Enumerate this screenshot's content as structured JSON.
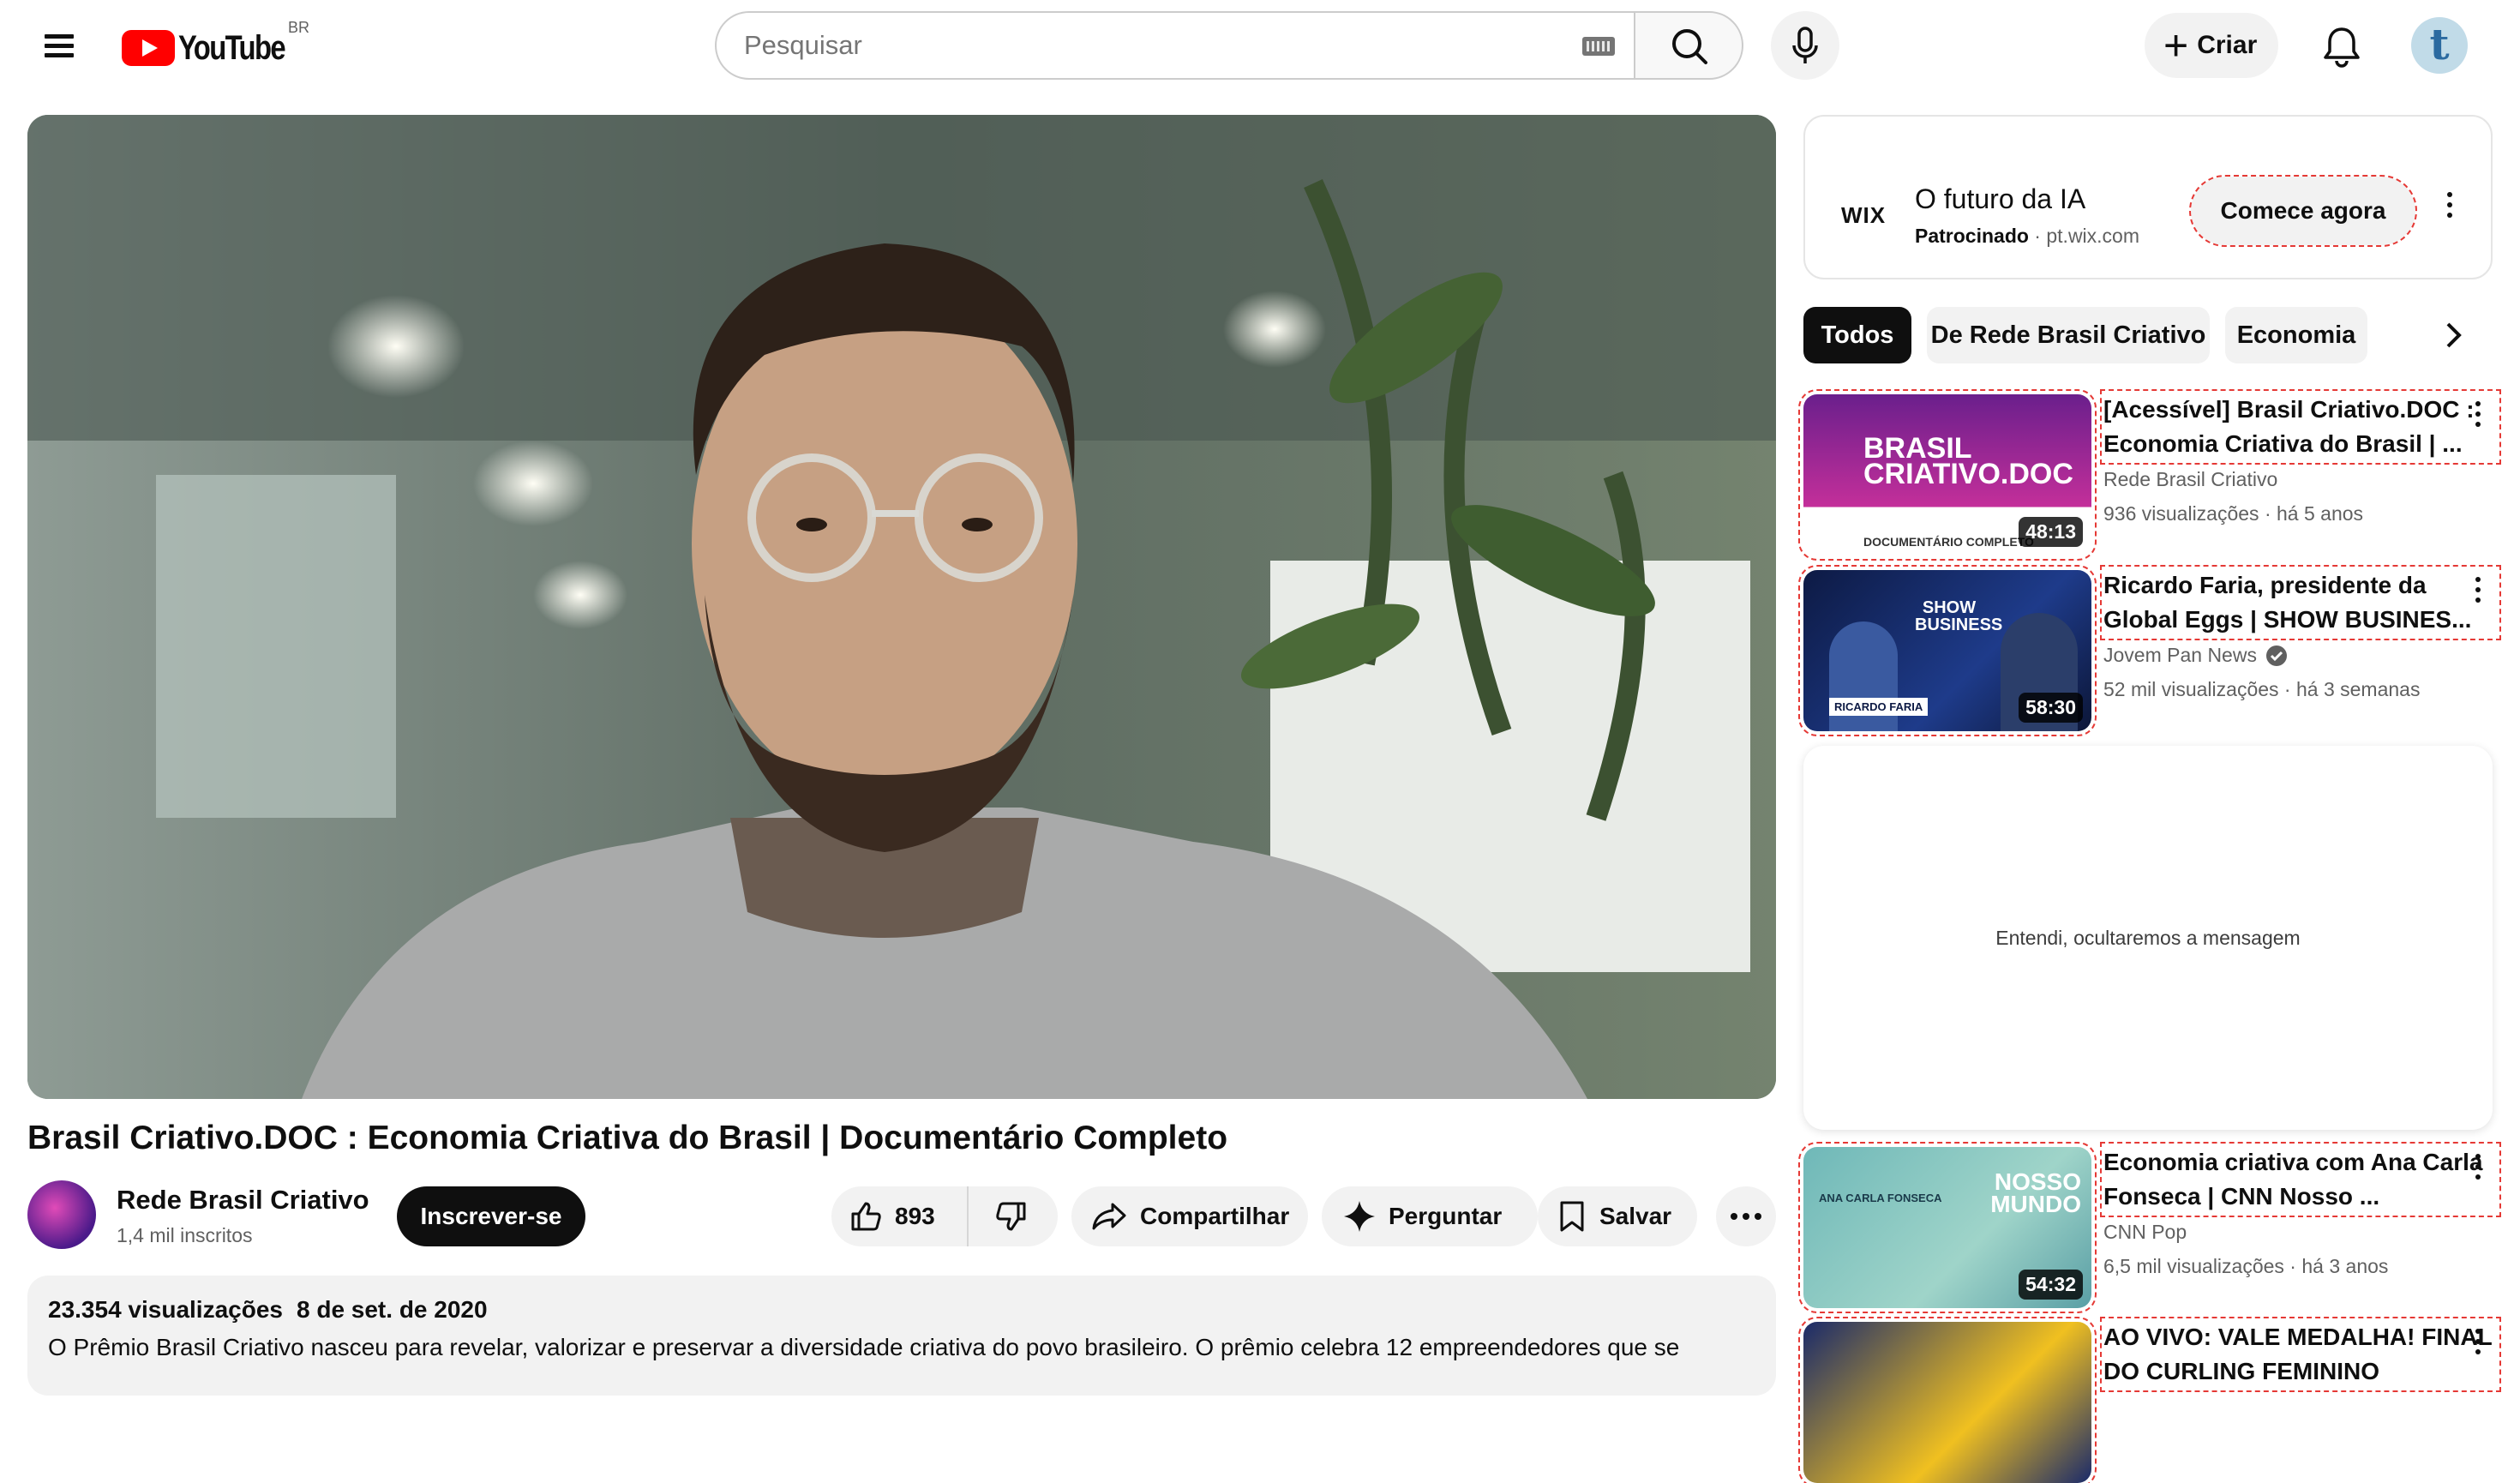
{
  "header": {
    "logo_text": "YouTube",
    "region": "BR",
    "search_placeholder": "Pesquisar",
    "create_label": "Criar",
    "avatar_letter": "t",
    "icons": [
      "menu-icon",
      "keyboard-icon",
      "search-icon",
      "mic-icon",
      "plus-icon",
      "bell-icon"
    ]
  },
  "video": {
    "title": "Brasil Criativo.DOC : Economia Criativa do Brasil | Documentário Completo",
    "channel": "Rede Brasil Criativo",
    "subscribers": "1,4 mil inscritos",
    "subscribe_label": "Inscrever-se",
    "likes": "893",
    "share_label": "Compartilhar",
    "ask_label": "Perguntar",
    "save_label": "Salvar",
    "views": "23.354 visualizações",
    "date": "8 de set. de 2020",
    "description": "O Prêmio Brasil Criativo nasceu para revelar, valorizar e preservar a diversidade criativa do povo brasileiro. O prêmio celebra 12 empreendedores que se"
  },
  "ad": {
    "logo": "WIX",
    "title": "O futuro da IA",
    "sponsored": "Patrocinado",
    "domain": "pt.wix.com",
    "cta": "Comece agora"
  },
  "chips": [
    "Todos",
    "De Rede Brasil Criativo",
    "Economia"
  ],
  "recommended": [
    {
      "title": "[Acessível] Brasil Criativo.DOC : Economia Criativa do Brasil | ...",
      "channel": "Rede Brasil Criativo",
      "views": "936 visualizações",
      "age": "há 5 anos",
      "duration": "48:13",
      "thumb_text": "BRASIL CRIATIVO.DOC",
      "thumb_sub": "DOCUMENTÁRIO COMPLETO",
      "verified": false
    },
    {
      "title": "Ricardo Faria, presidente da Global Eggs | SHOW BUSINES...",
      "channel": "Jovem Pan News",
      "views": "52 mil visualizações",
      "age": "há 3 semanas",
      "duration": "58:30",
      "thumb_text": "SHOW BUSINESS",
      "thumb_sub": "RICARDO FARIA",
      "verified": true
    },
    {
      "title": "Economia criativa com Ana Carla Fonseca | CNN Nosso ...",
      "channel": "CNN Pop",
      "views": "6,5 mil visualizações",
      "age": "há 3 anos",
      "duration": "54:32",
      "thumb_text": "NOSSO MUNDO",
      "thumb_sub": "ANA CARLA FONSECA",
      "verified": false
    },
    {
      "title": "AO VIVO: VALE MEDALHA! FINAL DO CURLING FEMININO",
      "channel": "",
      "views": "",
      "age": "",
      "duration": "",
      "thumb_text": "",
      "thumb_sub": "",
      "verified": false
    }
  ],
  "hidden_message": "Entendi, ocultaremos a mensagem"
}
